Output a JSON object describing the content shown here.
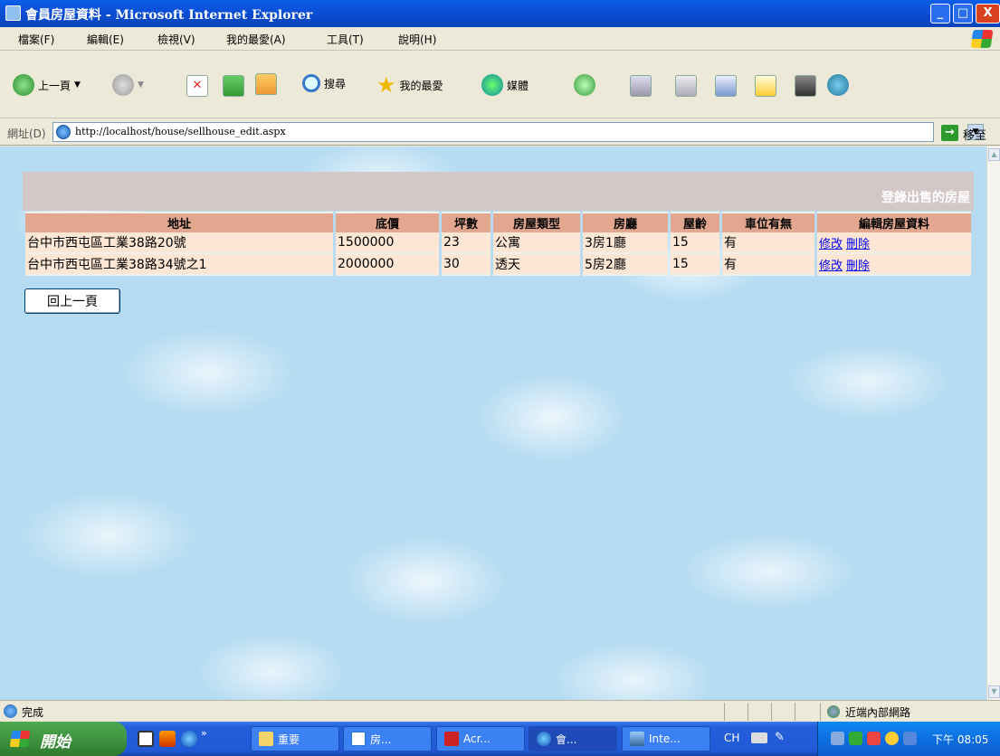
{
  "window": {
    "title": "會員房屋資料 - Microsoft Internet Explorer",
    "minimize": "_",
    "maximize": "□",
    "close": "X"
  },
  "menu": {
    "items": [
      "檔案(F)",
      "編輯(E)",
      "檢視(V)",
      "我的最愛(A)",
      "工具(T)",
      "說明(H)"
    ]
  },
  "toolbar": {
    "back_label": "上一頁",
    "search_label": "搜尋",
    "favorites_label": "我的最愛",
    "media_label": "媒體"
  },
  "address": {
    "label": "網址(D)",
    "url": "http://localhost/house/sellhouse_edit.aspx",
    "go_label": "移至"
  },
  "page": {
    "banner_title": "登錄出售的房屋",
    "columns": [
      "地址",
      "底價",
      "坪數",
      "房屋類型",
      "房廳",
      "屋齡",
      "車位有無",
      "編輯房屋資料"
    ],
    "rows": [
      {
        "address": "台中市西屯區工業38路20號",
        "price": "1500000",
        "ping": "23",
        "type": "公寓",
        "rooms": "3房1廳",
        "age": "15",
        "parking": "有",
        "edit": "修改",
        "delete": "刪除"
      },
      {
        "address": "台中市西屯區工業38路34號之1",
        "price": "2000000",
        "ping": "30",
        "type": "透天",
        "rooms": "5房2廳",
        "age": "15",
        "parking": "有",
        "edit": "修改",
        "delete": "刪除"
      }
    ],
    "back_button": "回上一頁"
  },
  "status": {
    "text": "完成",
    "zone": "近端內部網路"
  },
  "taskbar": {
    "start_label": "開始",
    "tasks": [
      "重要",
      "房...",
      "Acr...",
      "會...",
      "Inte..."
    ],
    "lang": "CH",
    "clock": "下午 08:05"
  },
  "colors": {
    "header_bg": "#e3a78f",
    "row_bg": "#fde6d4",
    "banner_bg": "#d4c7c7",
    "page_bg": "#b5dcf2"
  }
}
